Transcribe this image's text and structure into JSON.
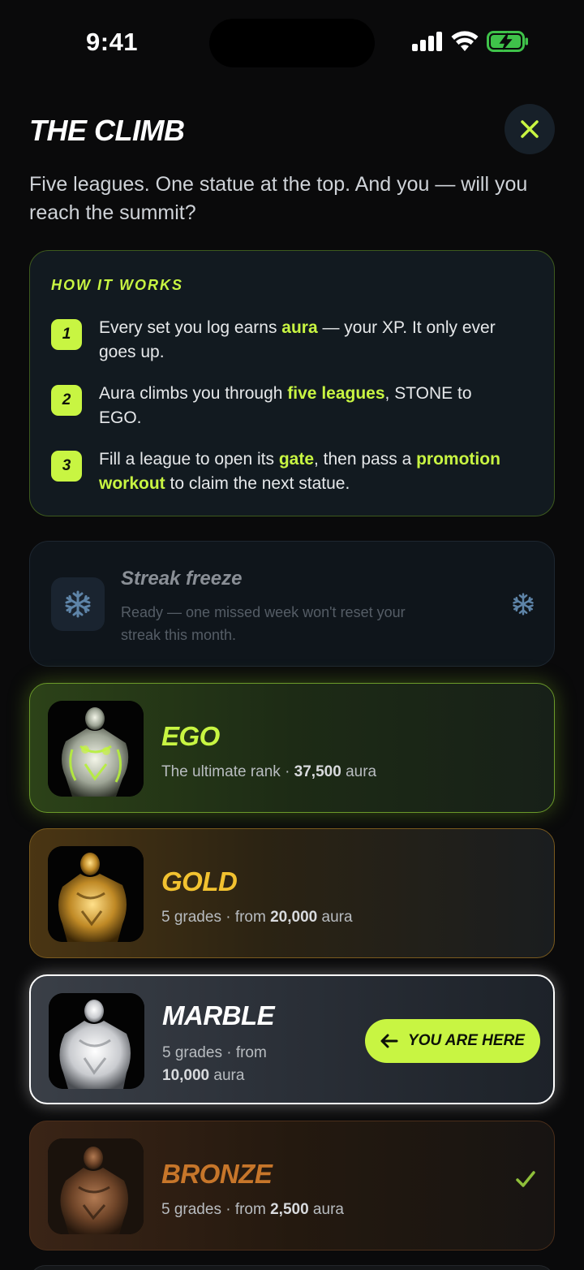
{
  "status_bar": {
    "time": "9:41"
  },
  "header": {
    "title": "THE CLIMB",
    "close_icon": "close-icon"
  },
  "subtitle": "Five leagues. One statue at the top. And you — will you reach the summit?",
  "how_it_works": {
    "title": "HOW IT WORKS",
    "steps": [
      {
        "num": "1",
        "parts": [
          "Every set you log earns ",
          "aura",
          " — your XP. It only ever goes up."
        ]
      },
      {
        "num": "2",
        "parts": [
          "Aura climbs you through ",
          "five leagues",
          ", STONE to EGO."
        ]
      },
      {
        "num": "3",
        "parts": [
          "Fill a league to open its ",
          "gate",
          ", then pass a ",
          "promotion workout",
          " to claim the next statue."
        ]
      }
    ]
  },
  "streak_freeze": {
    "title": "Streak freeze",
    "description": "Ready — one missed week won't reset your streak this month.",
    "icon": "snowflake-icon"
  },
  "leagues": [
    {
      "name": "EGO",
      "desc_prefix": "The ultimate rank · ",
      "desc_value": "37,500",
      "desc_suffix": " aura",
      "color": "#c8f542"
    },
    {
      "name": "GOLD",
      "desc_prefix": "5 grades · from ",
      "desc_value": "20,000",
      "desc_suffix": " aura",
      "color": "#f2c230"
    },
    {
      "name": "MARBLE",
      "desc_prefix": "5 grades · from",
      "desc_value": "10,000",
      "desc_suffix": " aura",
      "color": "#ffffff",
      "badge": "YOU ARE HERE"
    },
    {
      "name": "BRONZE",
      "desc_prefix": "5 grades · from ",
      "desc_value": "2,500",
      "desc_suffix": " aura",
      "color": "#c7762a",
      "completed": true
    }
  ],
  "colors": {
    "accent": "#c8f542",
    "background": "#0a0a0b"
  }
}
